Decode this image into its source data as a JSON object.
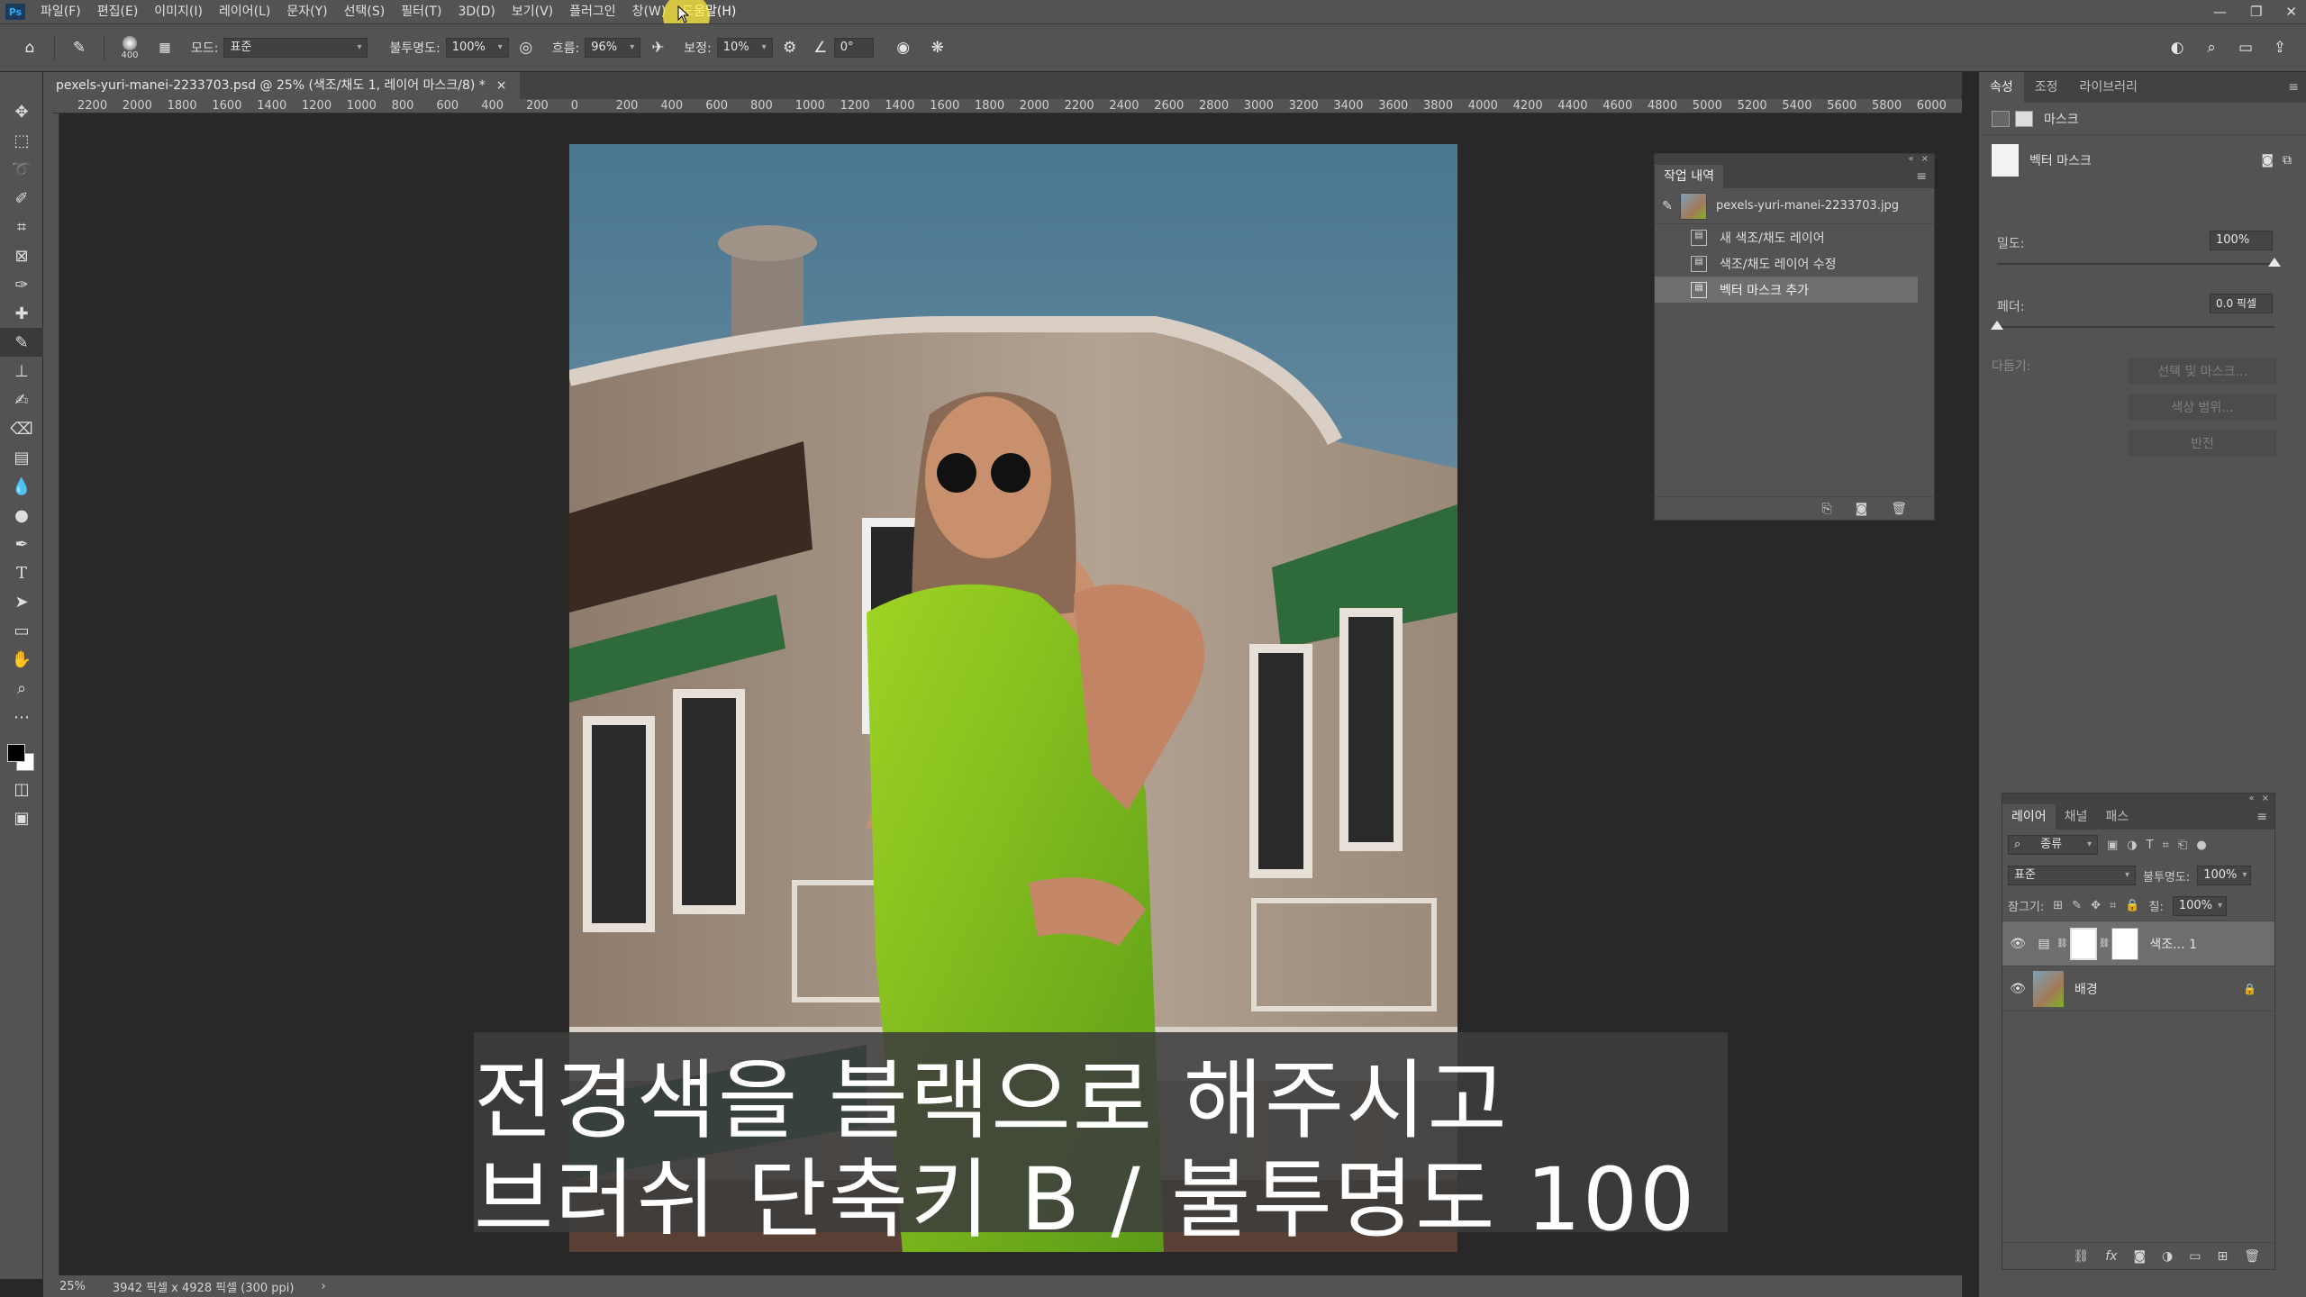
{
  "app": {
    "logo": "Ps"
  },
  "menu": [
    "파일(F)",
    "편집(E)",
    "이미지(I)",
    "레이어(L)",
    "문자(Y)",
    "선택(S)",
    "필터(T)",
    "3D(D)",
    "보기(V)",
    "플러그인",
    "창(W)",
    "도움말(H)"
  ],
  "window_controls": [
    "—",
    "❐",
    "✕"
  ],
  "options": {
    "brush_size": "400",
    "mode_label": "모드:",
    "mode_value": "표준",
    "opacity_label": "불투명도:",
    "opacity_value": "100%",
    "flow_label": "흐름:",
    "flow_value": "96%",
    "smoothing_label": "보정:",
    "smoothing_value": "10%",
    "angle_value": "0°"
  },
  "document": {
    "tab_title": "pexels-yuri-manei-2233703.psd @ 25% (색조/채도 1, 레이어 마스크/8) *",
    "close": "×"
  },
  "ruler_labels": [
    "2200",
    "2000",
    "1800",
    "1600",
    "1400",
    "1200",
    "1000",
    "800",
    "600",
    "400",
    "200",
    "0",
    "200",
    "400",
    "600",
    "800",
    "1000",
    "1200",
    "1400",
    "1600",
    "1800",
    "2000",
    "2200",
    "2400",
    "2600",
    "2800",
    "3000",
    "3200",
    "3400",
    "3600",
    "3800",
    "4000",
    "4200",
    "4400",
    "4600",
    "4800",
    "5000",
    "5200",
    "5400",
    "5600",
    "5800",
    "6000"
  ],
  "status": {
    "zoom": "25%",
    "doc_size": "3942 픽셀 x 4928 픽셀 (300 ppi)",
    "arrow": "›"
  },
  "history": {
    "title": "작업 내역",
    "snapshot": "pexels-yuri-manei-2233703.jpg",
    "items": [
      "새 색조/채도 레이어",
      "색조/채도 레이어 수정",
      "벡터 마스크 추가"
    ]
  },
  "properties": {
    "tabs": [
      "속성",
      "조정",
      "라이브러리"
    ],
    "mask_label": "마스크",
    "vector_mask_label": "벡터 마스크",
    "density_label": "밀도:",
    "density_value": "100%",
    "density_level": 1.0,
    "feather_label": "페더:",
    "feather_value": "0.0 픽셀",
    "feather_level": 0.0,
    "refine_label": "다듬기:",
    "buttons": [
      "선택 및 마스크...",
      "색상 범위...",
      "반전"
    ]
  },
  "layers": {
    "tabs": [
      "레이어",
      "채널",
      "패스"
    ],
    "filter_label": "종류",
    "blend_mode": "표준",
    "opacity_label": "불투명도:",
    "opacity_value": "100%",
    "lock_label": "잠그기:",
    "fill_label": "칠:",
    "fill_value": "100%",
    "rows": [
      {
        "name": "색조... 1"
      },
      {
        "name": "배경"
      }
    ],
    "footer_icons": [
      "link-icon",
      "fx-icon",
      "mask-icon",
      "adjustment-icon",
      "folder-icon",
      "new-layer-icon",
      "trash-icon"
    ]
  },
  "subtitle": {
    "line1": "전경색을 블랙으로 해주시고",
    "line2": "브러쉬 단축키 B / 불투명도 100"
  }
}
